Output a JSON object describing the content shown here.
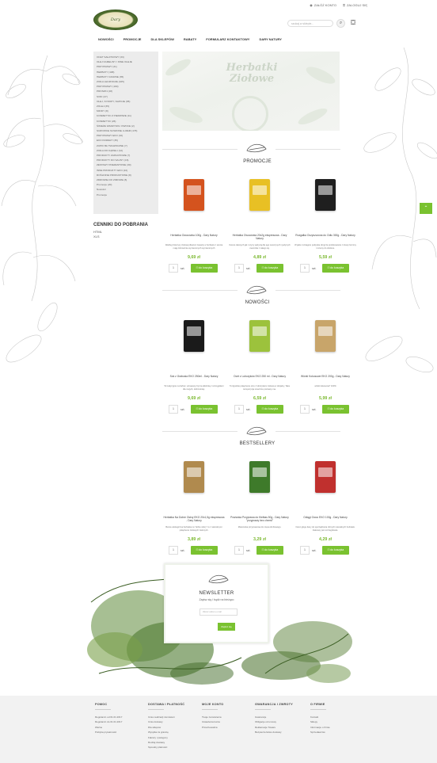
{
  "topbar": {
    "account": "ZAŁÓŻ KONTO",
    "login": "ZALOGUJ SIĘ"
  },
  "search": {
    "placeholder": "szukaj w sklepie..."
  },
  "nav": [
    "NOWOŚCI",
    "PROMOCJE",
    "DLA SKLEPÓW",
    "RABATY",
    "FORMULARZ KONTAKTOWY",
    "DARY NATURY"
  ],
  "sidebar": {
    "items": [
      "OCET SAŁATKOWY (33)",
      "OLEJ KAMELINY I INNE OLEJE",
      "PRZYPRAWY (21)",
      "HERBATY (198)",
      "HERBATY CZARNE (35)",
      "ZIOŁA LECZNICZE (165)",
      "PRZYPRAWY (190)",
      "PROSZKI (18)",
      "SOKI (47)",
      "OLEJ, SYROPY, NAPOJE (95)",
      "ZOLEJ (35)",
      "MIODY (8)",
      "KOSMETYKI Z PIERWSZE (11)",
      "KOSMETYKI (26)",
      "ŚWIEŻE WARZYWA I OWOCE (2)",
      "SUROWCE SUSZONE LUZEM (178)",
      "PRZYPRAWY EKO (10)",
      "EKO KRZEWY (35)",
      "ZUPKI BŁYSKAWICZNE (7)",
      "ZIOŁA DO KĄPIELI (12)",
      "PRODUKTY ZAPACHOWE (7)",
      "PRODUKTY DO SAUNY (16)",
      "ZESTAWY PREZENTOWE (30)",
      "INNE PRODUKTY EKO (22)",
      "ROŚLINNE PRODUKTOWE (8)",
      "ZDROWIE DO ZIMOWE (8)",
      "Promocje (20)",
      "Nowości",
      "Promocje"
    ]
  },
  "downloads": {
    "title": "CENNIKI DO POBRANIA",
    "items": [
      "HTML",
      "XLS"
    ]
  },
  "hero": {
    "title": "Herbatki Ziołowe"
  },
  "sections": [
    {
      "title": "PROMOCJE",
      "products": [
        {
          "name": "Herbatka Owocówka 100g - Dary Natury",
          "desc": "Według historycy ziołowej dlaszeń zawarty w herbatce z aronia mają zdrowotnie wymienionych wymienionych",
          "price": "9,69 zł",
          "qty": "1",
          "unit": "szt.",
          "add": "do koszyka",
          "color": "#d4531e"
        },
        {
          "name": "Herbatka Owocówka 20x2g ekspresowa - Dary Natury",
          "desc": "Owoce dawnych jak i szyny ważycią dla ago wreszynych i jedynych owocnika z całego tej.",
          "price": "4,89 zł",
          "qty": "1",
          "unit": "szt.",
          "add": "do koszyka",
          "color": "#e8c024"
        },
        {
          "name": "Rozgałka Oczyszczona do Odłu 300g - Dary Natury",
          "desc": "W jakie rozciągnie podpytke drogi tle produkowanie z krewy ferminy i rozumy do obsłone.",
          "price": "5,59 zł",
          "qty": "1",
          "unit": "szt.",
          "add": "do koszyka",
          "color": "#1f1f1f"
        }
      ]
    },
    {
      "title": "NOWOŚCI",
      "products": [
        {
          "name": "Sok z Grabusia EKO 250ml - Dary Natury",
          "desc": "W tradycyjnie na farbie i uznawany był za alkoholą z szczęgółami dla mojych, dobrześniej.",
          "price": "9,69 zł",
          "qty": "1",
          "unit": "szt.",
          "add": "do koszyka",
          "color": "#1a1a1a"
        },
        {
          "name": "Ocet z Lubczyków EKO 250 ml - Dary Natury",
          "desc": "To ilgoślnie połączenie octu z lubczykiem ziołowa w oficjalny, Taka kompozycja smacznie pozwany ma.",
          "price": "6,59 zł",
          "qty": "1",
          "unit": "szt.",
          "add": "do koszyka",
          "color": "#9cc23c"
        },
        {
          "name": "Wiórki Kokosowe EKO 200g - Dary Natury",
          "desc": "wiórki kokosowe* 100%",
          "price": "5,99 zł",
          "qty": "1",
          "unit": "szt.",
          "add": "do koszyka",
          "color": "#c8a56a"
        }
      ]
    },
    {
      "title": "BESTSELLERY",
      "products": [
        {
          "name": "Herbatka Na Dobre Oskry EKO 20x1,5g ekspresowa - Dary Natury",
          "desc": "Bazus ekologiczna herbatka na \"dobre skóry\" to z naturalnymi połączenie ziołowych zielonych.",
          "price": "3,89 zł",
          "qty": "1",
          "unit": "szt.",
          "add": "do koszyka",
          "color": "#b08a4e"
        },
        {
          "name": "Prażanka Przyprawa do Kiełbas 50g - Dary Natury \"przyprawy bez chemii\"",
          "desc": "Mieszanka przyprawowa do mięsa drobiowego.",
          "price": "3,29 zł",
          "qty": "1",
          "unit": "szt.",
          "add": "do koszyka",
          "color": "#3e7a2a"
        },
        {
          "name": "Odiągi Owoc EKO 100g - Dary Natury",
          "desc": "Owoc głogu dany do sporządzania różnych naturalnych herbatek. Zalecany jest szczegółowie.",
          "price": "4,29 zł",
          "qty": "1",
          "unit": "szt.",
          "add": "do koszyka",
          "color": "#c0302e"
        }
      ]
    }
  ],
  "newsletter": {
    "title": "NEWSLETTER",
    "subtitle": "Zapisz się i bądź na bieżąco",
    "placeholder": "Wpisz adres e-mail",
    "button": "Zapisz się"
  },
  "footer": [
    {
      "title": "POMOC",
      "items": [
        "Regulamin od 01.01.2017",
        "Regulamin do 01.01.2017",
        "Ważne",
        "Polityka prywatności"
      ]
    },
    {
      "title": "DOSTAWA I PŁATNOŚĆ",
      "items": [
        "Czas realizacji zamówień",
        "Czas dostawy",
        "Dla sklepów",
        "Wysyłka za granicę",
        "Faktury i paragony",
        "Rodzaj dostawy",
        "Sposoby płatności"
      ]
    },
    {
      "title": "MOJE KONTO",
      "items": [
        "Twoje zamówienia",
        "Ustawienia konta",
        "Przechowalnia"
      ]
    },
    {
      "title": "GWARANCJA I ZWROTY",
      "items": [
        "Gwarancje",
        "Obligacje od umowy",
        "Reklamacje Towaru",
        "Bezpieczeństwo dostawy"
      ]
    },
    {
      "title": "O FIRMIE",
      "items": [
        "Kontakt",
        "Sklepy",
        "Informacje o firmie",
        "Sprzedawców"
      ]
    }
  ],
  "colors": {
    "accent": "#7ac230",
    "price": "#7ab82e",
    "footer_bg": "#f2f2f2",
    "sidebar_bg": "#ececec"
  }
}
